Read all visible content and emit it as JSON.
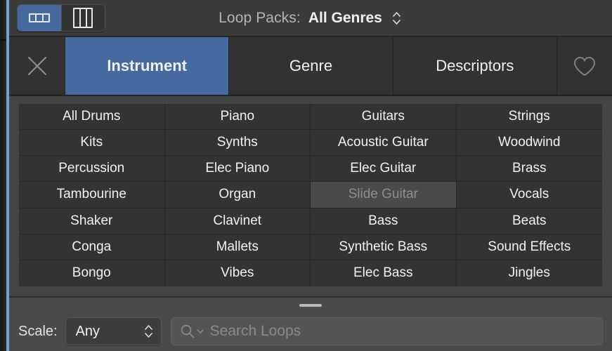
{
  "toolbar": {
    "view_modes": [
      {
        "name": "grid-horizontal-view",
        "icon": "grid-horizontal-icon",
        "active": true
      },
      {
        "name": "column-view",
        "icon": "grid-columns-icon",
        "active": false
      }
    ],
    "loop_packs_label": "Loop Packs:",
    "loop_packs_value": "All Genres",
    "stepper_icon": "updown-chevron-icon"
  },
  "tabs": {
    "close_icon": "close-x-icon",
    "favorite_icon": "heart-outline-icon",
    "items": [
      {
        "label": "Instrument",
        "selected": true
      },
      {
        "label": "Genre",
        "selected": false
      },
      {
        "label": "Descriptors",
        "selected": false
      }
    ]
  },
  "grid": {
    "columns": 4,
    "rows": 7,
    "cells": [
      "All Drums",
      "Piano",
      "Guitars",
      "Strings",
      "Kits",
      "Synths",
      "Acoustic Guitar",
      "Woodwind",
      "Percussion",
      "Elec Piano",
      "Elec Guitar",
      "Brass",
      "Tambourine",
      "Organ",
      "Slide Guitar",
      "Vocals",
      "Shaker",
      "Clavinet",
      "Bass",
      "Beats",
      "Conga",
      "Mallets",
      "Synthetic Bass",
      "Sound Effects",
      "Bongo",
      "Vibes",
      "Elec Bass",
      "Jingles"
    ],
    "hovered_cell": "Slide Guitar"
  },
  "bottom_bar": {
    "resize_handle": "resize-grip",
    "scale_label": "Scale:",
    "scale_value": "Any",
    "scale_stepper_icon": "updown-chevron-icon",
    "search_icon": "search-magnifier-icon",
    "search_dropdown_icon": "chevron-down-icon",
    "search_placeholder": "Search Loops",
    "search_value": ""
  },
  "colors": {
    "accent_blue": "#456aa0",
    "gutter_blue": "#7a9fd4",
    "toolbar_bg": "#3b3b3b",
    "tabbar_bg": "#323232",
    "grid_frame_bg": "#444444",
    "cell_bg": "#333333",
    "cell_hover_bg": "#4a4a4a",
    "bottom_bar_bg": "#4a4a4a"
  }
}
